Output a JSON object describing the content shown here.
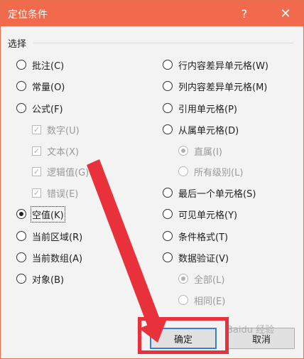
{
  "title": "定位条件",
  "help": "?",
  "close": "✕",
  "section": "选择",
  "left": [
    {
      "label": "批注(C)",
      "type": "radio",
      "checked": false,
      "disabled": false
    },
    {
      "label": "常量(O)",
      "type": "radio",
      "checked": false,
      "disabled": false
    },
    {
      "label": "公式(F)",
      "type": "radio",
      "checked": false,
      "disabled": false
    },
    {
      "label": "数字(U)",
      "type": "check",
      "checked": true,
      "disabled": true
    },
    {
      "label": "文本(X)",
      "type": "check",
      "checked": true,
      "disabled": true
    },
    {
      "label": "逻辑值(G)",
      "type": "check",
      "checked": true,
      "disabled": true
    },
    {
      "label": "错误(E)",
      "type": "check",
      "checked": true,
      "disabled": true
    },
    {
      "label": "空值(K)",
      "type": "radio",
      "checked": true,
      "disabled": false
    },
    {
      "label": "当前区域(R)",
      "type": "radio",
      "checked": false,
      "disabled": false
    },
    {
      "label": "当前数组(A)",
      "type": "radio",
      "checked": false,
      "disabled": false
    },
    {
      "label": "对象(B)",
      "type": "radio",
      "checked": false,
      "disabled": false
    }
  ],
  "right": [
    {
      "label": "行内容差异单元格(W)",
      "type": "radio",
      "checked": false,
      "disabled": false
    },
    {
      "label": "列内容差异单元格(M)",
      "type": "radio",
      "checked": false,
      "disabled": false
    },
    {
      "label": "引用单元格(P)",
      "type": "radio",
      "checked": false,
      "disabled": false
    },
    {
      "label": "从属单元格(D)",
      "type": "radio",
      "checked": false,
      "disabled": false
    },
    {
      "label": "直属(I)",
      "type": "radio",
      "checked": true,
      "disabled": true
    },
    {
      "label": "所有级别(L)",
      "type": "radio",
      "checked": false,
      "disabled": true
    },
    {
      "label": "最后一个单元格(S)",
      "type": "radio",
      "checked": false,
      "disabled": false
    },
    {
      "label": "可见单元格(Y)",
      "type": "radio",
      "checked": false,
      "disabled": false
    },
    {
      "label": "条件格式(T)",
      "type": "radio",
      "checked": false,
      "disabled": false
    },
    {
      "label": "数据验证(V)",
      "type": "radio",
      "checked": false,
      "disabled": false
    },
    {
      "label": "全部(L)",
      "type": "radio",
      "checked": true,
      "disabled": true
    },
    {
      "label": "相同(E)",
      "type": "radio",
      "checked": false,
      "disabled": true
    }
  ],
  "buttons": {
    "ok": "确定",
    "cancel": "取消"
  },
  "watermark": "Baidu 经验",
  "colors": {
    "titlebar": "#f06a4b",
    "highlight": "#e8313a"
  }
}
